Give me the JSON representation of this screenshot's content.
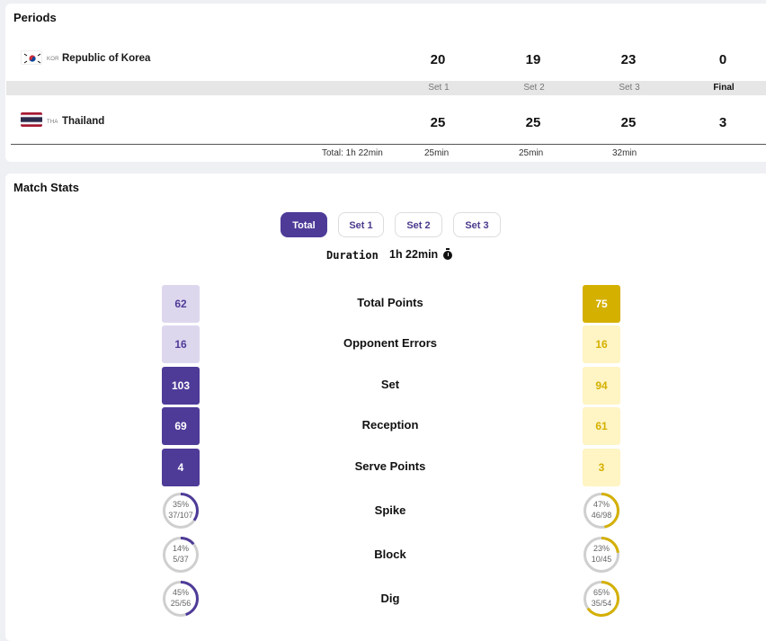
{
  "periods": {
    "title": "Periods",
    "team_a": {
      "code": "KOR",
      "name": "Republic of Korea",
      "scores": [
        "20",
        "19",
        "23",
        "0"
      ]
    },
    "team_b": {
      "code": "THA",
      "name": "Thailand",
      "scores": [
        "25",
        "25",
        "25",
        "3"
      ]
    },
    "set_labels": [
      "Set 1",
      "Set 2",
      "Set 3",
      "Final"
    ],
    "total_label": "Total: 1h 22min",
    "set_durations": [
      "25min",
      "25min",
      "32min"
    ]
  },
  "match_stats": {
    "title": "Match Stats",
    "tabs": [
      "Total",
      "Set 1",
      "Set 2",
      "Set 3"
    ],
    "active_tab": "Total",
    "duration_label": "Duration",
    "duration_value": "1h 22min",
    "colors": {
      "team_a_dark": "#4e3b98",
      "team_a_light": "#ddd7ee",
      "team_b_dark": "#d4b000",
      "team_b_light": "#fff4c4",
      "ring_track": "#cfcfcf"
    },
    "rows": [
      {
        "label": "Total Points",
        "a": "62",
        "b": "75",
        "a_style": "light",
        "b_style": "dark"
      },
      {
        "label": "Opponent Errors",
        "a": "16",
        "b": "16",
        "a_style": "light",
        "b_style": "light"
      },
      {
        "label": "Set",
        "a": "103",
        "b": "94",
        "a_style": "dark",
        "b_style": "light"
      },
      {
        "label": "Reception",
        "a": "69",
        "b": "61",
        "a_style": "dark",
        "b_style": "light"
      },
      {
        "label": "Serve Points",
        "a": "4",
        "b": "3",
        "a_style": "dark",
        "b_style": "light"
      }
    ],
    "rings": [
      {
        "label": "Spike",
        "a_pct": "35%",
        "a_frac": "37/107",
        "a_value": 0.35,
        "b_pct": "47%",
        "b_frac": "46/98",
        "b_value": 0.47
      },
      {
        "label": "Block",
        "a_pct": "14%",
        "a_frac": "5/37",
        "a_value": 0.14,
        "b_pct": "23%",
        "b_frac": "10/45",
        "b_value": 0.23
      },
      {
        "label": "Dig",
        "a_pct": "45%",
        "a_frac": "25/56",
        "a_value": 0.45,
        "b_pct": "65%",
        "b_frac": "35/54",
        "b_value": 0.65
      }
    ]
  }
}
